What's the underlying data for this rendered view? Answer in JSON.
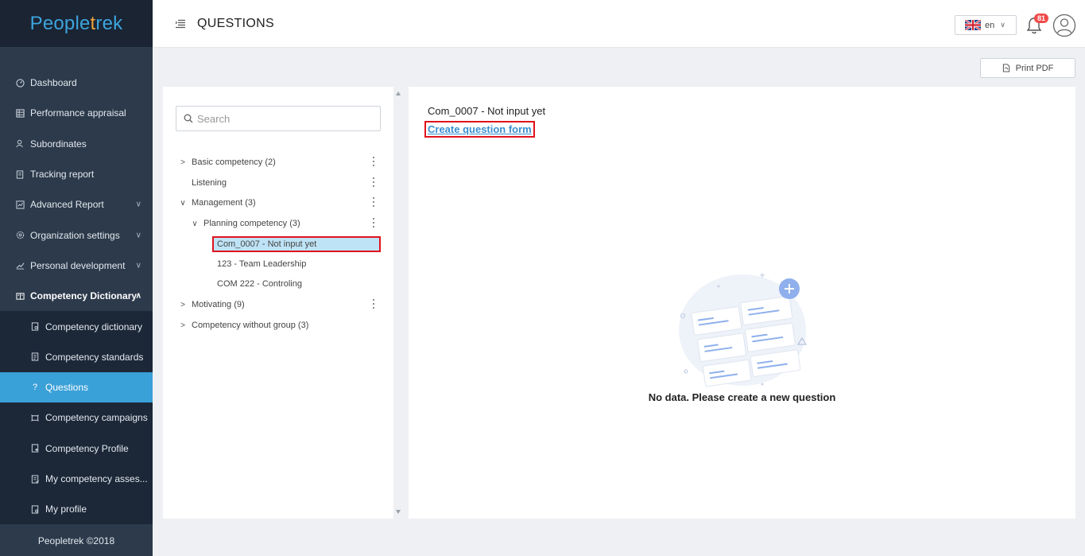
{
  "app": {
    "brand": "Peopletrek"
  },
  "sidebar": {
    "items": [
      {
        "label": "Dashboard",
        "icon": "dashboard-icon"
      },
      {
        "label": "Performance appraisal",
        "icon": "table-icon"
      },
      {
        "label": "Subordinates",
        "icon": "users-icon"
      },
      {
        "label": "Tracking report",
        "icon": "report-icon"
      },
      {
        "label": "Advanced Report",
        "icon": "chart-icon"
      },
      {
        "label": "Organization settings",
        "icon": "gear-icon"
      },
      {
        "label": "Personal development",
        "icon": "trend-icon"
      },
      {
        "label": "Competency Dictionary",
        "icon": "book-icon"
      }
    ],
    "subitems": [
      {
        "label": "Competency dictionary"
      },
      {
        "label": "Competency standards"
      },
      {
        "label": "Questions"
      },
      {
        "label": "Competency campaigns"
      },
      {
        "label": "Competency Profile"
      },
      {
        "label": "My competency asses..."
      },
      {
        "label": "My profile"
      }
    ],
    "footer": "Peopletrek ©2018"
  },
  "header": {
    "title": "QUESTIONS",
    "language": "en",
    "notification_count": "81"
  },
  "toolbar": {
    "print_label": "Print PDF"
  },
  "tree": {
    "search_placeholder": "Search",
    "nodes": [
      {
        "label": "Basic competency (2)",
        "arrow": ">"
      },
      {
        "label": "Listening",
        "arrow": ""
      },
      {
        "label": "Management (3)",
        "arrow": "∨"
      },
      {
        "label": "Planning competency (3)",
        "arrow": "∨"
      },
      {
        "label": "Com_0007 - Not input yet"
      },
      {
        "label": "123 - Team Leadership"
      },
      {
        "label": "COM 222 - Controling"
      },
      {
        "label": "Motivating (9)",
        "arrow": ">"
      },
      {
        "label": "Competency without group (3)",
        "arrow": ">"
      }
    ]
  },
  "content": {
    "title": "Com_0007 - Not input yet",
    "create_link": "Create question form",
    "empty_message": "No data. Please create a new question"
  },
  "colors": {
    "accent": "#3aa0d8",
    "sidebar": "#2c3a4b",
    "highlight": "#e0121c",
    "link": "#3a8fd0"
  }
}
